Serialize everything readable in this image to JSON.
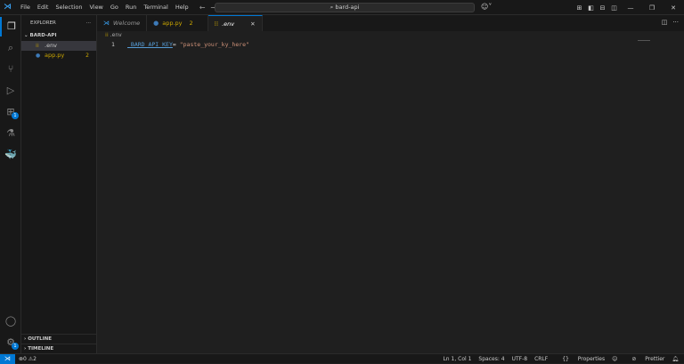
{
  "titlebar": {
    "menu": [
      "File",
      "Edit",
      "Selection",
      "View",
      "Go",
      "Run",
      "Terminal",
      "Help"
    ],
    "search": "bard-api"
  },
  "sidebar": {
    "title": "EXPLORER",
    "more": "···",
    "folder": "BARD-API",
    "files": [
      {
        "name": ".env",
        "icon": "env-file-icon",
        "selected": true
      },
      {
        "name": "app.py",
        "icon": "python-file-icon",
        "problems": "2"
      }
    ],
    "outline": "OUTLINE",
    "timeline": "TIMELINE"
  },
  "activity": {
    "extensions_badge": "1",
    "settings_badge": "1"
  },
  "tabs": [
    {
      "label": "Welcome",
      "italic": true
    },
    {
      "label": "app.py",
      "problems": "2"
    },
    {
      "label": ".env",
      "active": true
    }
  ],
  "breadcrumb": ".env",
  "editor": {
    "lines": [
      {
        "number": "1",
        "key": "_BARD_API_KEY",
        "eq": "= ",
        "value": "\"paste_your_ky_here\""
      }
    ]
  },
  "status": {
    "errors": "0",
    "warnings": "2",
    "position": "Ln 1, Col 1",
    "spaces": "Spaces: 4",
    "encoding": "UTF-8",
    "eol": "CRLF",
    "language": "Properties",
    "prettier": "Prettier"
  },
  "colors": {
    "accent": "#0078d4",
    "warning": "#cca700",
    "string": "#ce9178",
    "keyword": "#569cd6"
  }
}
